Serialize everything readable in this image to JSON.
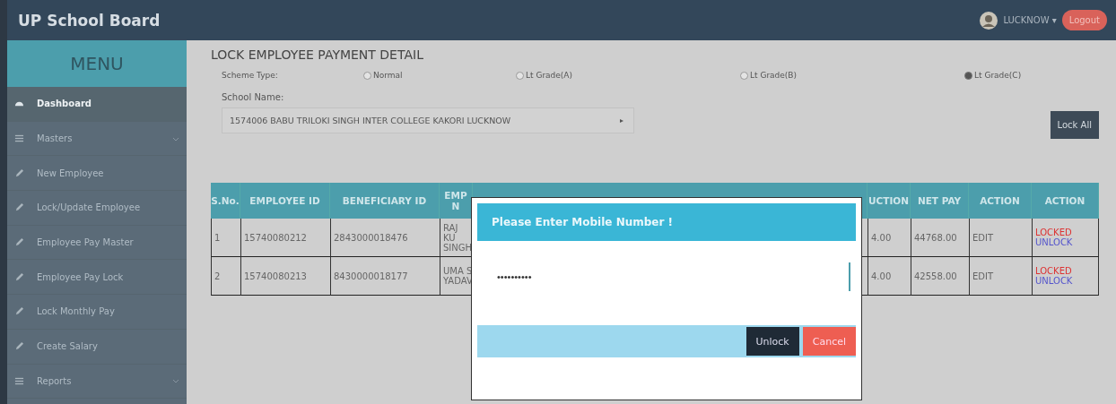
{
  "header": {
    "title": "UP School Board",
    "user": "LUCKNOW ▾",
    "logout": "Logout"
  },
  "sidebar": {
    "title": "MENU",
    "items": [
      {
        "label": "Dashboard",
        "kind": "home",
        "selected": true
      },
      {
        "label": "Masters",
        "kind": "group",
        "selected": false
      },
      {
        "label": "New Employee",
        "kind": "link",
        "selected": false
      },
      {
        "label": "Lock/Update Employee",
        "kind": "link",
        "selected": false
      },
      {
        "label": "Employee Pay Master",
        "kind": "link",
        "selected": false
      },
      {
        "label": "Employee Pay Lock",
        "kind": "link",
        "selected": false
      },
      {
        "label": "Lock Monthly Pay",
        "kind": "link",
        "selected": false
      },
      {
        "label": "Create Salary",
        "kind": "link",
        "selected": false
      },
      {
        "label": "Reports",
        "kind": "group",
        "selected": false
      }
    ]
  },
  "page": {
    "title": "LOCK EMPLOYEE PAYMENT DETAIL",
    "option_label": "Scheme Type:",
    "options": [
      {
        "label": "Normal",
        "selected": false
      },
      {
        "label": "Lt Grade(A)",
        "selected": false
      },
      {
        "label": "Lt Grade(B)",
        "selected": false
      },
      {
        "label": "Lt Grade(C)",
        "selected": true
      }
    ],
    "school_label": "School Name:",
    "school_value": "1574006 BABU TRILOKI SINGH INTER COLLEGE KAKORI LUCKNOW",
    "lock_all": "Lock All"
  },
  "table": {
    "columns": [
      "S.No.",
      "EMPLOYEE ID",
      "BENEFICIARY ID",
      "EMP N",
      "UCTION",
      "NET PAY",
      "ACTION",
      "ACTION"
    ],
    "rows": [
      {
        "cells": [
          "1",
          "15740080212",
          "2843000018476",
          "RAJ KU SINGH",
          "4.00",
          "44768.00",
          "EDIT"
        ],
        "status": "LOCKED",
        "unlock": "UNLOCK"
      },
      {
        "cells": [
          "2",
          "15740080213",
          "8430000018177",
          "UMA S YADAV",
          "4.00",
          "42558.00",
          "EDIT"
        ],
        "status": "LOCKED",
        "unlock": "UNLOCK"
      }
    ]
  },
  "dialog": {
    "title": "Please Enter Mobile Number !",
    "value": "••••••••••",
    "buttons": [
      {
        "label": "Unlock",
        "kind": "primary"
      },
      {
        "label": "Cancel",
        "kind": "danger"
      }
    ]
  }
}
